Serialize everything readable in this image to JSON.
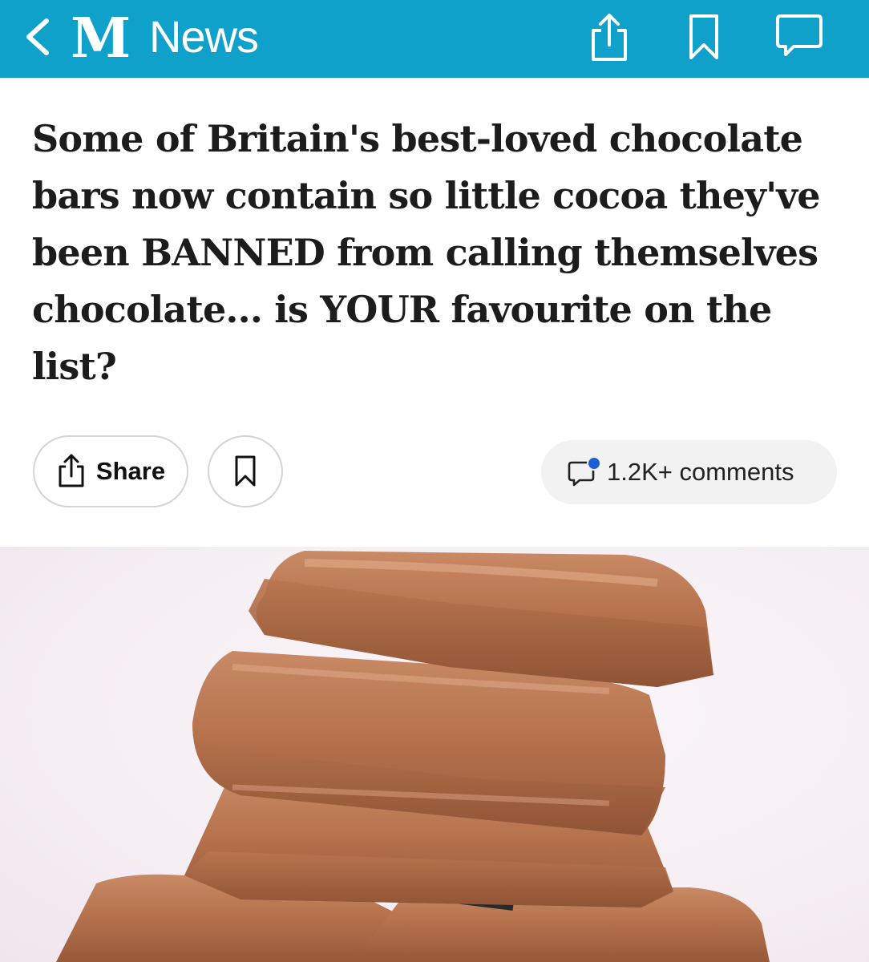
{
  "topbar": {
    "brand_mark": "M",
    "section": "News",
    "background": "#0fa1c9",
    "icons": [
      "back-chevron-icon",
      "share-icon",
      "bookmark-icon",
      "comment-icon"
    ]
  },
  "article": {
    "headline": "Some of Britain's best-loved chocolate bars now contain so little cocoa they've been BANNED from calling themselves chocolate... is YOUR favourite on the list?"
  },
  "actions": {
    "share_label": "Share",
    "comments_label": "1.2K+ comments",
    "notification_dot_color": "#1a5fd4"
  },
  "hero": {
    "subject": "stacked milk chocolate pieces"
  }
}
